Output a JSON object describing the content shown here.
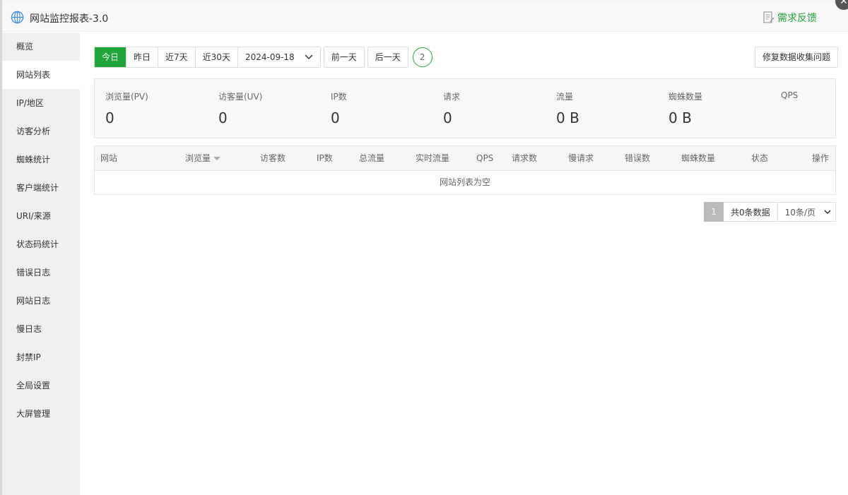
{
  "window": {
    "title": "网站监控报表-3.0",
    "feedback_label": "需求反馈",
    "accent_color": "#20a53a"
  },
  "sidebar": {
    "items": [
      {
        "label": "概览"
      },
      {
        "label": "网站列表",
        "active": true
      },
      {
        "label": "IP/地区"
      },
      {
        "label": "访客分析"
      },
      {
        "label": "蜘蛛统计"
      },
      {
        "label": "客户端统计"
      },
      {
        "label": "URI/来源"
      },
      {
        "label": "状态码统计"
      },
      {
        "label": "错误日志"
      },
      {
        "label": "网站日志"
      },
      {
        "label": "慢日志"
      },
      {
        "label": "封禁IP"
      },
      {
        "label": "全局设置"
      },
      {
        "label": "大屏管理"
      }
    ]
  },
  "toolbar": {
    "ranges": [
      "今日",
      "昨日",
      "近7天",
      "近30天"
    ],
    "active_range": "今日",
    "date": "2024-09-18",
    "prev_day": "前一天",
    "next_day": "后一天",
    "refresh_count": "2",
    "fix_button": "修复数据收集问题"
  },
  "stats": [
    {
      "label": "浏览量(PV)",
      "value": "0"
    },
    {
      "label": "访客量(UV)",
      "value": "0"
    },
    {
      "label": "IP数",
      "value": "0"
    },
    {
      "label": "请求",
      "value": "0"
    },
    {
      "label": "流量",
      "value": "0 B"
    },
    {
      "label": "蜘蛛数量",
      "value": "0 B"
    },
    {
      "label": "QPS",
      "value": ""
    }
  ],
  "table": {
    "columns": [
      "网站",
      "浏览量",
      "访客数",
      "IP数",
      "总流量",
      "实时流量",
      "QPS",
      "请求数",
      "慢请求",
      "错误数",
      "蜘蛛数量",
      "状态",
      "操作"
    ],
    "empty_text": "网站列表为空"
  },
  "pager": {
    "current_page": "1",
    "total_text": "共0条数据",
    "page_size": "10条/页"
  }
}
